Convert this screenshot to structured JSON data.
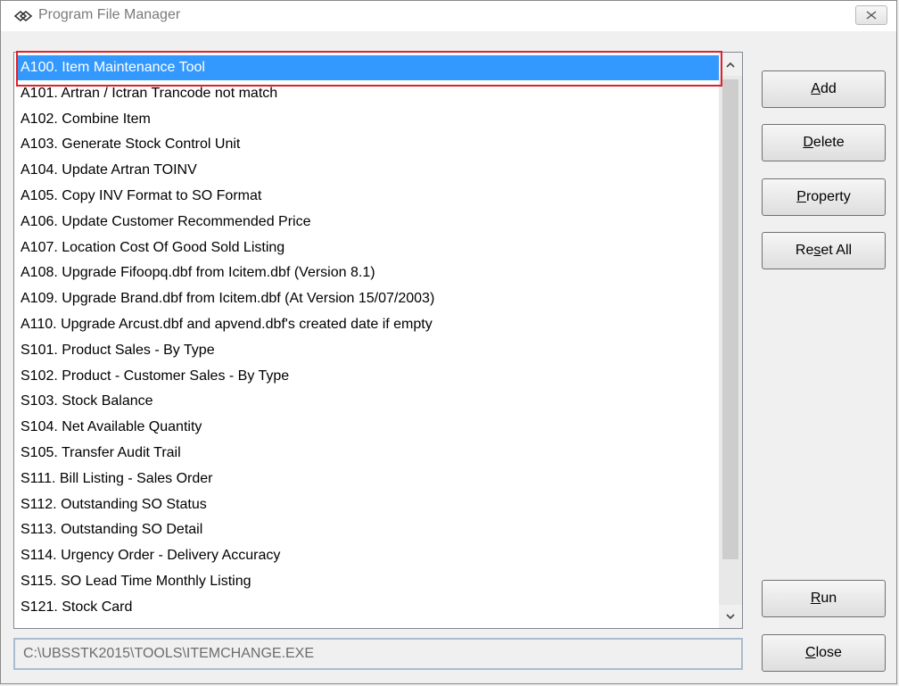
{
  "window": {
    "title": "Program File Manager"
  },
  "list": {
    "items": [
      "A100. Item Maintenance Tool",
      "A101. Artran / Ictran Trancode not match",
      "A102. Combine Item",
      "A103. Generate Stock Control Unit",
      "A104. Update Artran TOINV",
      "A105. Copy INV Format to SO Format",
      "A106. Update Customer Recommended Price",
      "A107. Location Cost Of Good Sold Listing",
      "A108. Upgrade Fifoopq.dbf from Icitem.dbf (Version 8.1)",
      "A109. Upgrade Brand.dbf from Icitem.dbf (At Version 15/07/2003)",
      "A110. Upgrade Arcust.dbf and apvend.dbf's created date if empty",
      "S101. Product Sales - By Type",
      "S102. Product - Customer Sales - By Type",
      "S103. Stock Balance",
      "S104. Net Available Quantity",
      "S105. Transfer Audit Trail",
      "S111. Bill Listing - Sales Order",
      "S112. Outstanding SO Status",
      "S113. Outstanding SO Detail",
      "S114. Urgency Order - Delivery Accuracy",
      "S115. SO Lead Time Monthly Listing",
      "S121. Stock Card"
    ],
    "selected_index": 0
  },
  "path_field": {
    "value": "C:\\UBSSTK2015\\TOOLS\\ITEMCHANGE.EXE"
  },
  "buttons": {
    "add": {
      "accel": "A",
      "rest": "dd"
    },
    "delete": {
      "accel": "D",
      "rest": "elete"
    },
    "property": {
      "accel": "P",
      "rest": "roperty"
    },
    "reset_all": {
      "pre": "Re",
      "accel": "s",
      "rest": "et All"
    },
    "run": {
      "accel": "R",
      "rest": "un"
    },
    "close": {
      "accel": "C",
      "rest": "lose"
    }
  },
  "colors": {
    "selection": "#3399ff",
    "highlight_border": "#e0202a"
  }
}
